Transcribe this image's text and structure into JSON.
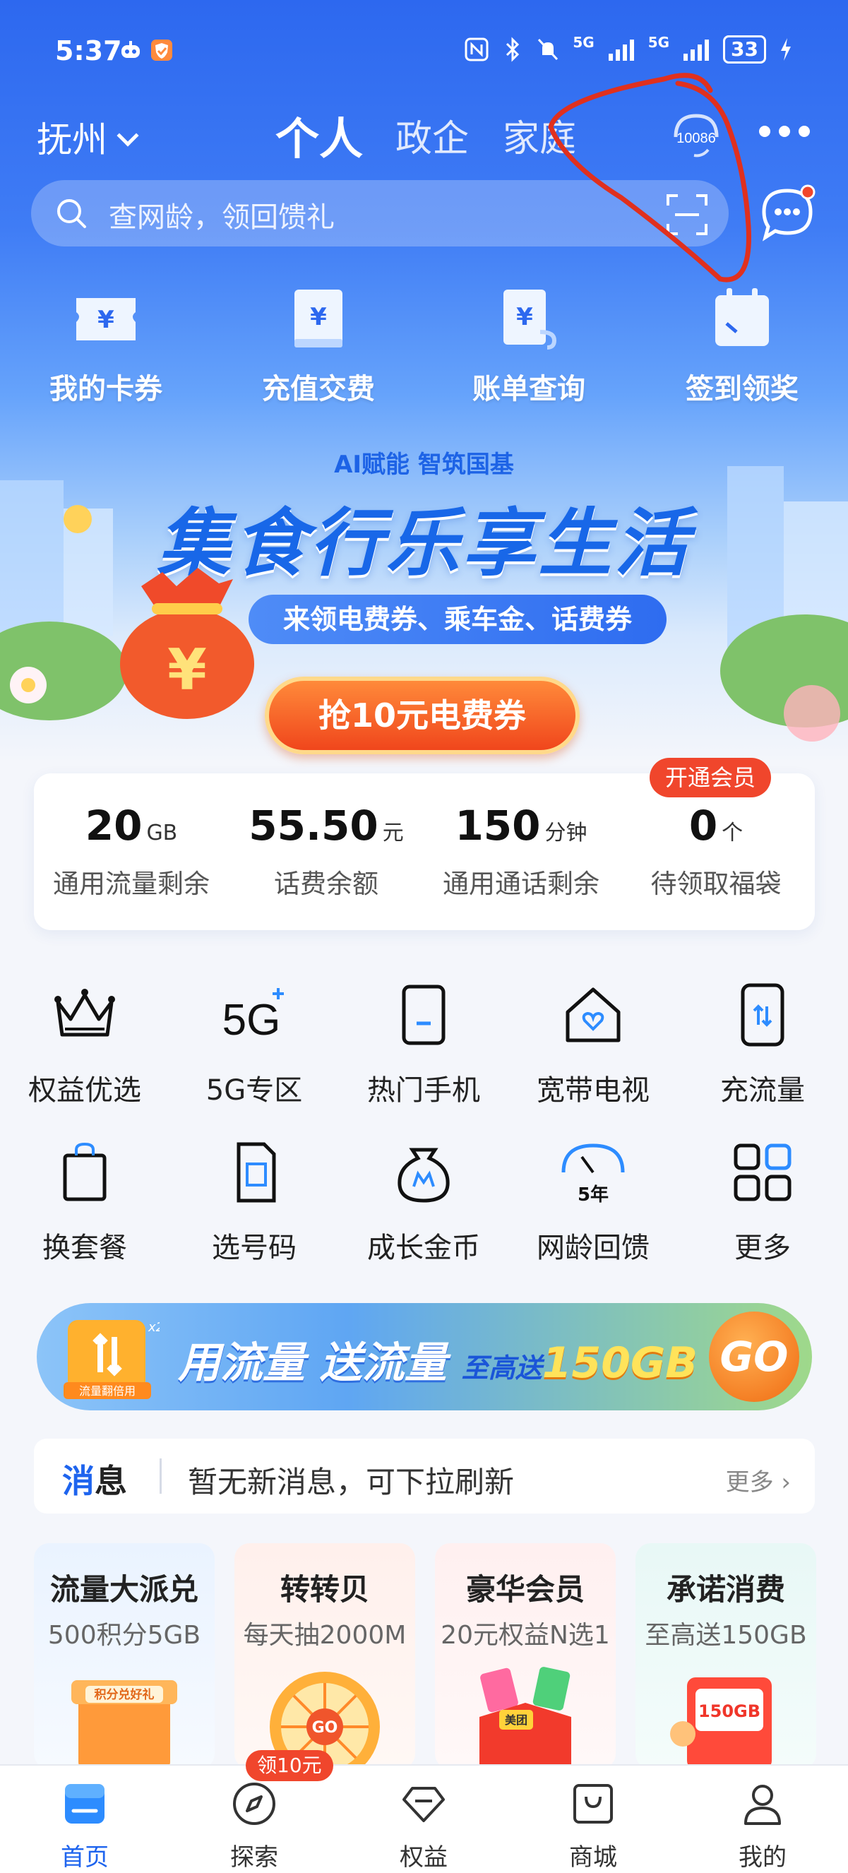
{
  "status_bar": {
    "time": "5:37",
    "signal_1": "5G",
    "signal_2": "5G",
    "battery": "33"
  },
  "top_nav": {
    "city": "抚州",
    "tabs": [
      "个人",
      "政企",
      "家庭"
    ],
    "hotline": "10086"
  },
  "search": {
    "placeholder": "查网龄，领回馈礼"
  },
  "quick_actions": [
    "我的卡券",
    "充值交费",
    "账单查询",
    "签到领奖"
  ],
  "banner": {
    "brand": "AI赋能 智筑国基",
    "title": "集食行乐享生活",
    "subtitle": "来领电费券、乘车金、话费券",
    "button": "抢10元电费券",
    "coin_symbol": "¥"
  },
  "stats": [
    {
      "value": "20",
      "unit": "GB",
      "label": "通用流量剩余"
    },
    {
      "value": "55.50",
      "unit": "元",
      "label": "话费余额"
    },
    {
      "value": "150",
      "unit": "分钟",
      "label": "通用通话剩余"
    },
    {
      "value": "0",
      "unit": "个",
      "label": "待领取福袋"
    }
  ],
  "member_badge": "开通会员",
  "services_row1": [
    {
      "label": "权益优选",
      "icon": "crown-icon"
    },
    {
      "label": "5G专区",
      "icon": "5g-icon"
    },
    {
      "label": "热门手机",
      "icon": "phone-icon"
    },
    {
      "label": "宽带电视",
      "icon": "home-heart-icon"
    },
    {
      "label": "充流量",
      "icon": "phone-data-icon"
    }
  ],
  "services_row2": [
    {
      "label": "换套餐",
      "icon": "bag-icon"
    },
    {
      "label": "选号码",
      "icon": "sim-icon"
    },
    {
      "label": "成长金币",
      "icon": "coin-pouch-icon"
    },
    {
      "label": "网龄回馈",
      "icon": "gauge-icon"
    },
    {
      "label": "更多",
      "icon": "grid-icon"
    }
  ],
  "gauge_text": "5年",
  "five_g_text": "5G",
  "promo": {
    "text": "用流量 送流量",
    "sub": "至高送",
    "gb": "150GB",
    "go": "GO",
    "box_label": "流量翻倍用",
    "multiplier": "x2"
  },
  "messages": {
    "title_a": "消",
    "title_b": "息",
    "text": "暂无新消息，可下拉刷新",
    "more": "更多 ›"
  },
  "feature_cards": [
    {
      "title": "流量大派兑",
      "sub": "500积分5GB",
      "art_text": "积分兑好礼"
    },
    {
      "title": "转转贝",
      "sub": "每天抽2000M",
      "art_text": "GO"
    },
    {
      "title": "豪华会员",
      "sub": "20元权益N选1",
      "art_text": "美团"
    },
    {
      "title": "承诺消费",
      "sub": "至高送150GB",
      "art_text": "150GB"
    }
  ],
  "bottom_nav": [
    {
      "label": "首页",
      "icon": "home-icon"
    },
    {
      "label": "探索",
      "icon": "compass-icon"
    },
    {
      "label": "权益",
      "icon": "diamond-icon"
    },
    {
      "label": "商城",
      "icon": "shopping-bag-icon"
    },
    {
      "label": "我的",
      "icon": "person-icon"
    }
  ],
  "bottom_badge": "领10元",
  "colors": {
    "brand_blue": "#1e64ee",
    "hero_top": "#2d68ef",
    "accent_red": "#f0462c",
    "accent_orange": "#f0701c",
    "annotation_red": "#e0301e"
  }
}
